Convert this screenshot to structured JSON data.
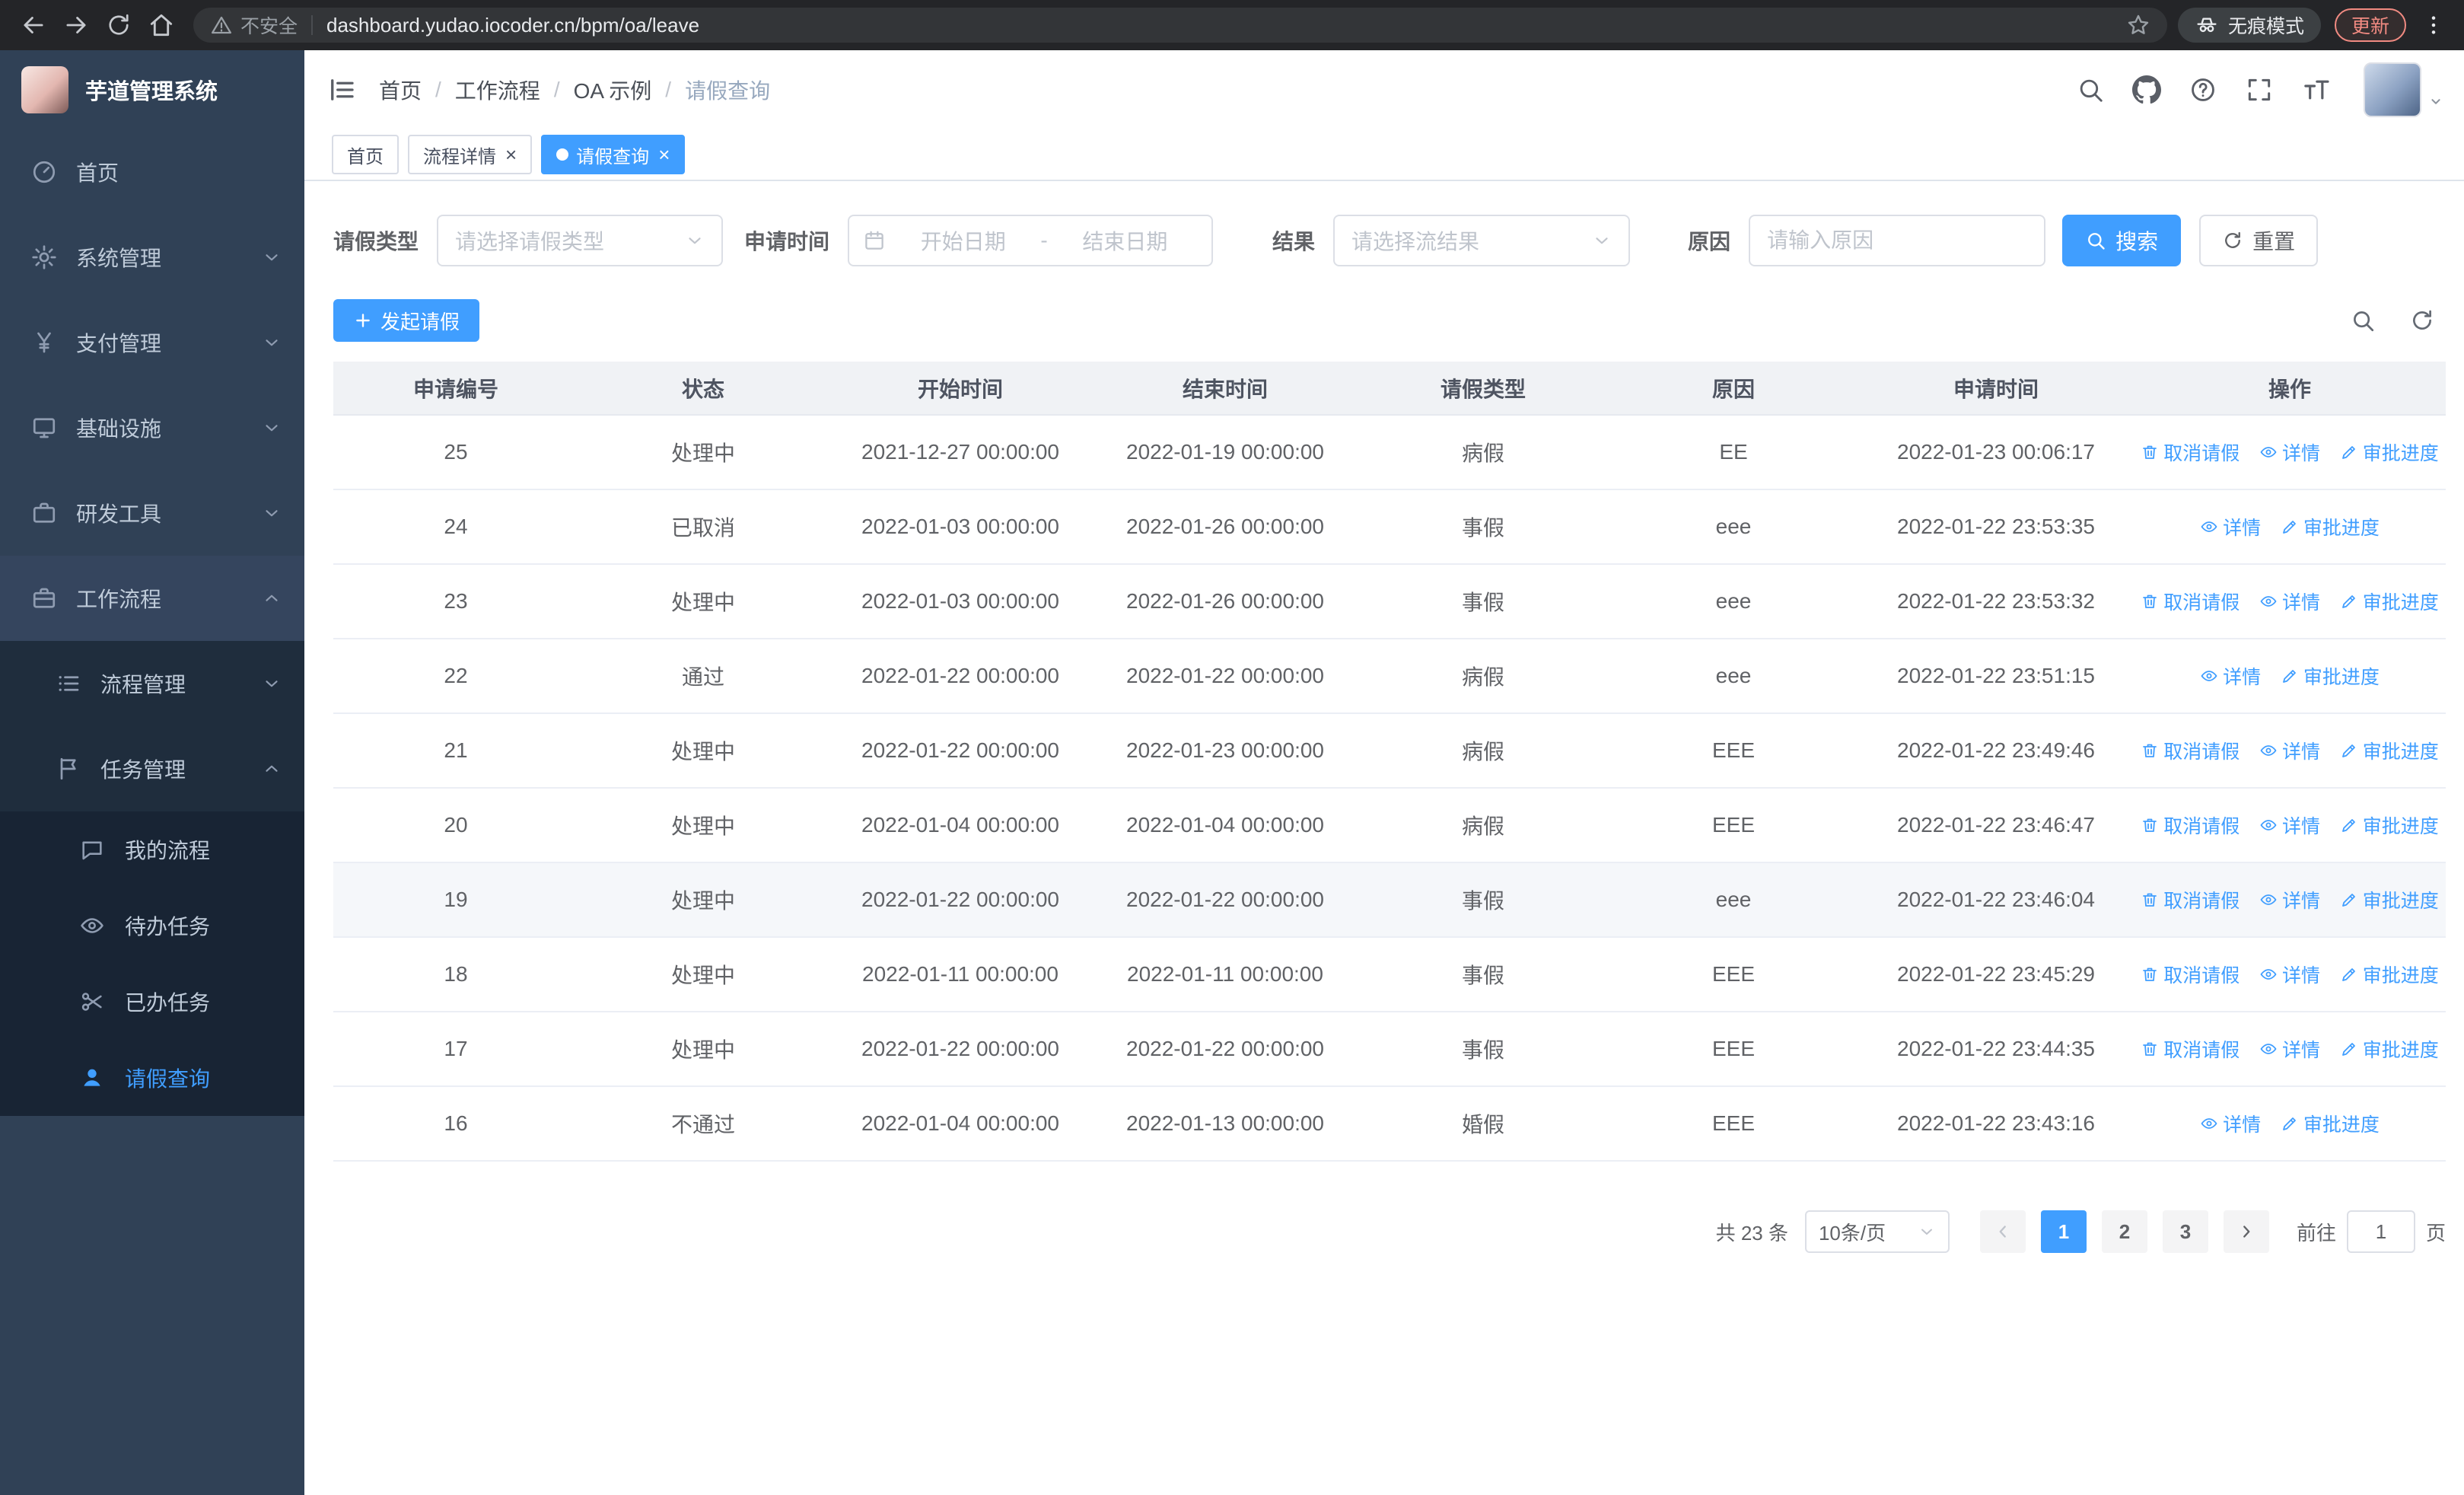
{
  "colors": {
    "primary": "#409EFF",
    "sidebar_bg": "#304156",
    "sidebar_submenu_bg": "#1f2d3d",
    "link": "#409EFF",
    "table_header_bg": "#f0f2f5",
    "active_tab_bg": "#409EFF"
  },
  "browser": {
    "security_label": "不安全",
    "url": "dashboard.yudao.iocoder.cn/bpm/oa/leave",
    "incognito_label": "无痕模式",
    "update_button": "更新"
  },
  "sidebar": {
    "logo_title": "芋道管理系统",
    "items": [
      {
        "label": "首页",
        "icon": "dashboard-icon"
      },
      {
        "label": "系统管理",
        "icon": "gear-icon"
      },
      {
        "label": "支付管理",
        "icon": "yen-icon"
      },
      {
        "label": "基础设施",
        "icon": "monitor-icon"
      },
      {
        "label": "研发工具",
        "icon": "toolbox-icon"
      },
      {
        "label": "工作流程",
        "icon": "briefcase-icon",
        "expanded": true
      },
      {
        "label": "流程管理",
        "icon": "list-icon"
      },
      {
        "label": "任务管理",
        "icon": "flag-icon",
        "expanded": true
      },
      {
        "label": "我的流程",
        "icon": "chat-icon"
      },
      {
        "label": "待办任务",
        "icon": "eye-icon"
      },
      {
        "label": "已办任务",
        "icon": "scissors-icon"
      },
      {
        "label": "请假查询",
        "icon": "user-icon",
        "active": true
      }
    ]
  },
  "header": {
    "breadcrumb": [
      "首页",
      "工作流程",
      "OA 示例",
      "请假查询"
    ],
    "breadcrumb_separator": "/"
  },
  "tabs": [
    {
      "label": "首页"
    },
    {
      "label": "流程详情"
    },
    {
      "label": "请假查询"
    }
  ],
  "filters": {
    "leave_type_label": "请假类型",
    "leave_type_placeholder": "请选择请假类型",
    "apply_time_label": "申请时间",
    "start_date_placeholder": "开始日期",
    "range_separator": "-",
    "end_date_placeholder": "结束日期",
    "result_label": "结果",
    "result_placeholder": "请选择流结果",
    "reason_label": "原因",
    "reason_placeholder": "请输入原因",
    "search_button": "搜索",
    "reset_button": "重置"
  },
  "toolbar": {
    "create_button": "发起请假"
  },
  "table": {
    "columns": [
      "申请编号",
      "状态",
      "开始时间",
      "结束时间",
      "请假类型",
      "原因",
      "申请时间",
      "操作"
    ],
    "action_labels": {
      "cancel": "取消请假",
      "detail": "详情",
      "progress": "审批进度"
    },
    "rows": [
      {
        "id": "25",
        "status": "处理中",
        "start_time": "2021-12-27 00:00:00",
        "end_time": "2022-01-19 00:00:00",
        "leave_type": "病假",
        "reason": "EE",
        "apply_time": "2022-01-23 00:06:17",
        "can_cancel": true,
        "highlighted": false
      },
      {
        "id": "24",
        "status": "已取消",
        "start_time": "2022-01-03 00:00:00",
        "end_time": "2022-01-26 00:00:00",
        "leave_type": "事假",
        "reason": "eee",
        "apply_time": "2022-01-22 23:53:35",
        "can_cancel": false,
        "highlighted": false
      },
      {
        "id": "23",
        "status": "处理中",
        "start_time": "2022-01-03 00:00:00",
        "end_time": "2022-01-26 00:00:00",
        "leave_type": "事假",
        "reason": "eee",
        "apply_time": "2022-01-22 23:53:32",
        "can_cancel": true,
        "highlighted": false
      },
      {
        "id": "22",
        "status": "通过",
        "start_time": "2022-01-22 00:00:00",
        "end_time": "2022-01-22 00:00:00",
        "leave_type": "病假",
        "reason": "eee",
        "apply_time": "2022-01-22 23:51:15",
        "can_cancel": false,
        "highlighted": false
      },
      {
        "id": "21",
        "status": "处理中",
        "start_time": "2022-01-22 00:00:00",
        "end_time": "2022-01-23 00:00:00",
        "leave_type": "病假",
        "reason": "EEE",
        "apply_time": "2022-01-22 23:49:46",
        "can_cancel": true,
        "highlighted": false
      },
      {
        "id": "20",
        "status": "处理中",
        "start_time": "2022-01-04 00:00:00",
        "end_time": "2022-01-04 00:00:00",
        "leave_type": "病假",
        "reason": "EEE",
        "apply_time": "2022-01-22 23:46:47",
        "can_cancel": true,
        "highlighted": false
      },
      {
        "id": "19",
        "status": "处理中",
        "start_time": "2022-01-22 00:00:00",
        "end_time": "2022-01-22 00:00:00",
        "leave_type": "事假",
        "reason": "eee",
        "apply_time": "2022-01-22 23:46:04",
        "can_cancel": true,
        "highlighted": true
      },
      {
        "id": "18",
        "status": "处理中",
        "start_time": "2022-01-11 00:00:00",
        "end_time": "2022-01-11 00:00:00",
        "leave_type": "事假",
        "reason": "EEE",
        "apply_time": "2022-01-22 23:45:29",
        "can_cancel": true,
        "highlighted": false
      },
      {
        "id": "17",
        "status": "处理中",
        "start_time": "2022-01-22 00:00:00",
        "end_time": "2022-01-22 00:00:00",
        "leave_type": "事假",
        "reason": "EEE",
        "apply_time": "2022-01-22 23:44:35",
        "can_cancel": true,
        "highlighted": false
      },
      {
        "id": "16",
        "status": "不通过",
        "start_time": "2022-01-04 00:00:00",
        "end_time": "2022-01-13 00:00:00",
        "leave_type": "婚假",
        "reason": "EEE",
        "apply_time": "2022-01-22 23:43:16",
        "can_cancel": false,
        "highlighted": false
      }
    ]
  },
  "pagination": {
    "total": "共 23 条",
    "page_size": "10条/页",
    "pages": [
      "1",
      "2",
      "3"
    ],
    "active_page": "1",
    "goto_label": "前往",
    "goto_value": "1",
    "goto_unit": "页"
  }
}
